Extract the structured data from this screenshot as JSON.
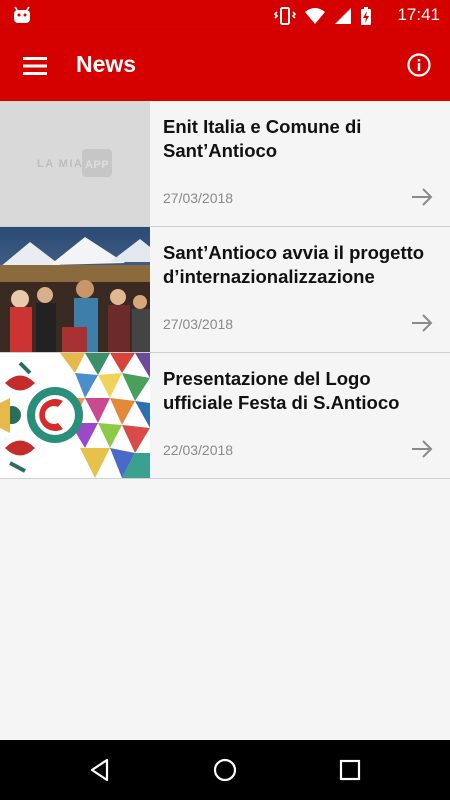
{
  "status_bar": {
    "time": "17:41",
    "icons": [
      "android-icon",
      "vibrate-icon",
      "wifi-icon",
      "signal-icon",
      "battery-charging-icon"
    ]
  },
  "app_bar": {
    "title": "News",
    "left_icon": "menu-icon",
    "right_icon": "info-icon",
    "color": "#d50000"
  },
  "placeholder_logo": {
    "text_left": "LA MIA",
    "text_box": "APP"
  },
  "news": [
    {
      "title": "Enit Italia e Comune di Sant’Antioco",
      "date": "27/03/2018",
      "thumbnail": "placeholder-logo"
    },
    {
      "title": "Sant’Antioco avvia il progetto d’internazionalizzazione",
      "date": "27/03/2018",
      "thumbnail": "event-photo"
    },
    {
      "title": "Presentazione del Logo ufficiale Festa di S.Antioco",
      "date": "22/03/2018",
      "thumbnail": "festival-logo"
    }
  ],
  "nav_bar": {
    "icons": [
      "back-icon",
      "home-icon",
      "recents-icon"
    ]
  }
}
